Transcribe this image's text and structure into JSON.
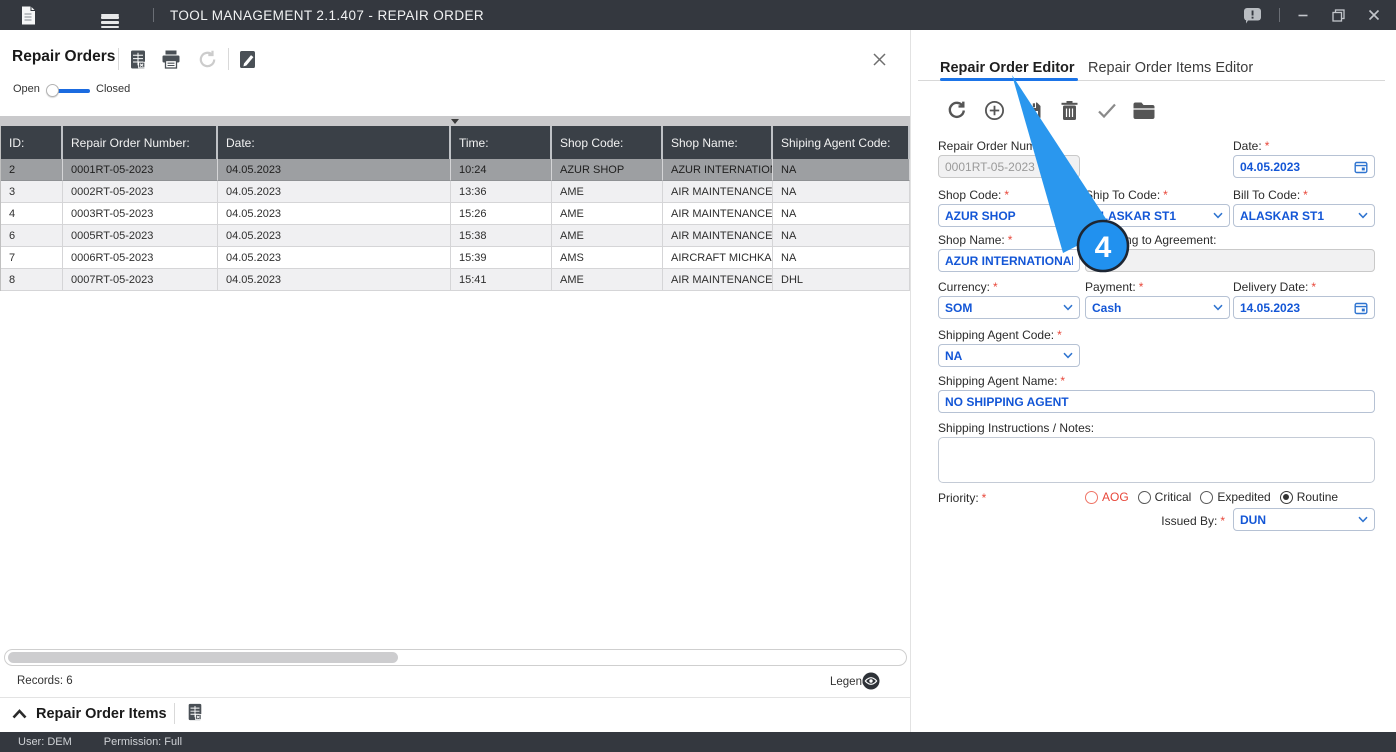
{
  "titlebar": {
    "title": "TOOL MANAGEMENT 2.1.407 - REPAIR ORDER"
  },
  "ui": {
    "required_marker": "*"
  },
  "left_panel": {
    "title": "Repair Orders",
    "toggle": {
      "open": "Open",
      "closed": "Closed",
      "state": "Open"
    },
    "table": {
      "columns": [
        "ID:",
        "Repair Order Number:",
        "Date:",
        "Time:",
        "Shop Code:",
        "Shop Name:",
        "Shiping Agent Code:"
      ],
      "rows": [
        [
          "2",
          "0001RT-05-2023",
          "04.05.2023",
          "10:24",
          "AZUR SHOP",
          "AZUR INTERNATION...",
          "NA"
        ],
        [
          "3",
          "0002RT-05-2023",
          "04.05.2023",
          "13:36",
          "AME",
          "AIR MAINTENANCE E...",
          "NA"
        ],
        [
          "4",
          "0003RT-05-2023",
          "04.05.2023",
          "15:26",
          "AME",
          "AIR MAINTENANCE E...",
          "NA"
        ],
        [
          "6",
          "0005RT-05-2023",
          "04.05.2023",
          "15:38",
          "AME",
          "AIR MAINTENANCE E...",
          "NA"
        ],
        [
          "7",
          "0006RT-05-2023",
          "04.05.2023",
          "15:39",
          "AMS",
          "AIRCRAFT MICHKAS...",
          "NA"
        ],
        [
          "8",
          "0007RT-05-2023",
          "04.05.2023",
          "15:41",
          "AME",
          "AIR MAINTENANCE E...",
          "DHL"
        ]
      ],
      "selected_row": "0001RT-05-2023"
    },
    "records": "Records: 6",
    "legend": "Legend"
  },
  "items_section": {
    "title": "Repair Order Items"
  },
  "editor": {
    "tabs": {
      "active": "Repair Order Editor",
      "inactive": "Repair Order Items Editor"
    },
    "fields": {
      "repair_order_number": {
        "label": "Repair Order Number:",
        "value": "0001RT-05-2023",
        "disabled": true
      },
      "date": {
        "label": "Date:",
        "value": "04.05.2023",
        "required": true
      },
      "shop_code": {
        "label": "Shop Code:",
        "value": "AZUR SHOP",
        "required": true
      },
      "ship_to_code": {
        "label": "Ship To Code:",
        "value": "ALASKAR ST1",
        "required": true
      },
      "bill_to_code": {
        "label": "Bill To Code:",
        "value": "ALASKAR ST1",
        "required": true
      },
      "shop_name": {
        "label": "Shop Name:",
        "value": "AZUR INTERNATIONAL COM",
        "required": true
      },
      "according_to_agreement": {
        "label": "According to Agreement:",
        "value": "",
        "disabled": true
      },
      "currency": {
        "label": "Currency:",
        "value": "SOM",
        "required": true
      },
      "payment": {
        "label": "Payment:",
        "value": "Cash",
        "required": true
      },
      "delivery_date": {
        "label": "Delivery Date:",
        "value": "14.05.2023",
        "required": true
      },
      "shipping_agent_code": {
        "label": "Shipping Agent Code:",
        "value": "NA",
        "required": true
      },
      "shipping_agent_name": {
        "label": "Shipping Agent Name:",
        "value": "NO SHIPPING AGENT",
        "required": true
      },
      "shipping_instructions": {
        "label": "Shipping Instructions / Notes:",
        "value": ""
      },
      "priority": {
        "label": "Priority:",
        "options": [
          "AOG",
          "Critical",
          "Expedited",
          "Routine"
        ],
        "selected": "Routine",
        "required": true
      },
      "issued_by": {
        "label": "Issued By:",
        "value": "DUN",
        "required": true
      }
    }
  },
  "callout": {
    "number": "4"
  },
  "statusbar": {
    "user": "User: DEM",
    "permission": "Permission: Full"
  },
  "colors": {
    "titlebar_bg": "#34383f",
    "table_header_bg": "#3a4047",
    "selected_row_bg": "#9d9fa2",
    "accent_blue": "#1356d6",
    "tab_underline": "#1b74e8",
    "callout_blue": "#2196f3",
    "required_red": "#e8473a"
  }
}
